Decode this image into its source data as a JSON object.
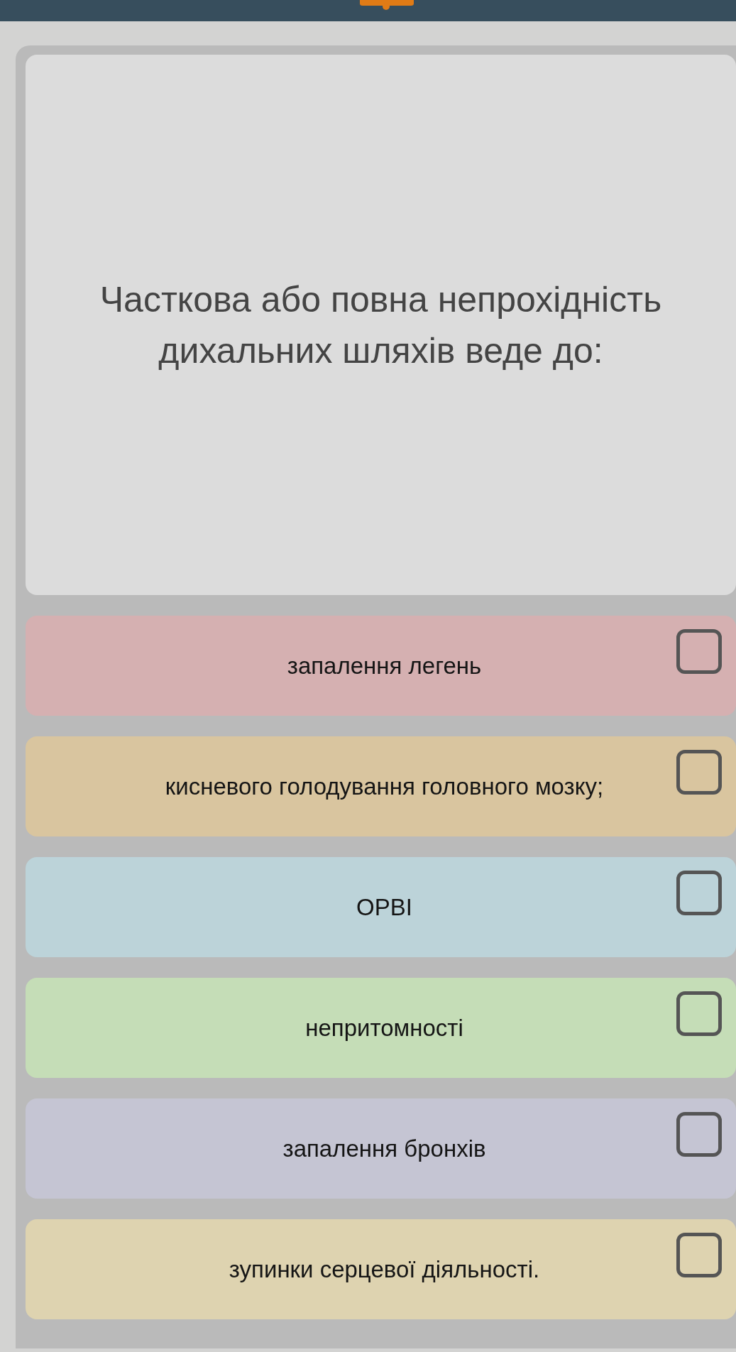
{
  "question": {
    "text": "Часткова або повна непрохідність дихальних шляхів веде до:"
  },
  "options": [
    {
      "text": "запалення легень",
      "color": "#d5b0b1",
      "checked": false
    },
    {
      "text": "кисневого голодування головного мозку;",
      "color": "#d9c59f",
      "checked": false
    },
    {
      "text": "ОРВІ",
      "color": "#bcd3d9",
      "checked": false
    },
    {
      "text": "непритомності",
      "color": "#c5ddb7",
      "checked": false
    },
    {
      "text": "запалення бронхів",
      "color": "#c5c5d3",
      "checked": false
    },
    {
      "text": "зупинки серцевої діяльності.",
      "color": "#ded3b0",
      "checked": false
    }
  ]
}
